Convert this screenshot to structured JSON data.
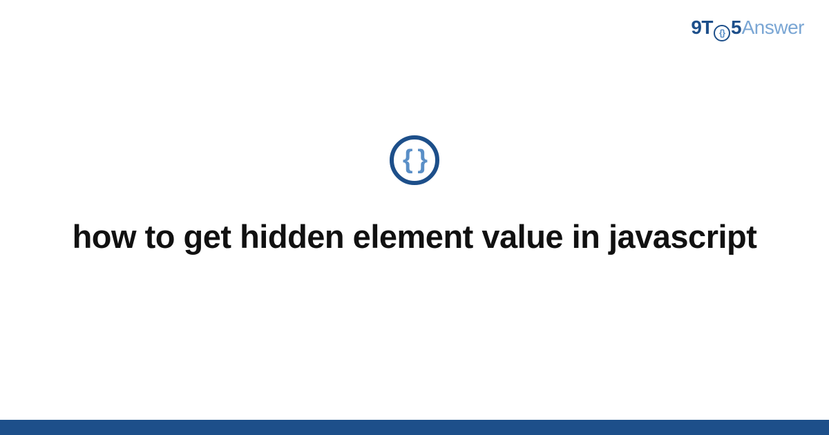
{
  "brand": {
    "part1": "9T",
    "o_inner": "{}",
    "part2": "5",
    "part3": "Answer"
  },
  "icon": {
    "glyph": "{ }"
  },
  "page": {
    "title": "how to get hidden element value in javascript"
  },
  "colors": {
    "primary": "#1d4f8a",
    "secondary": "#5a8fc7",
    "text": "#111111"
  }
}
